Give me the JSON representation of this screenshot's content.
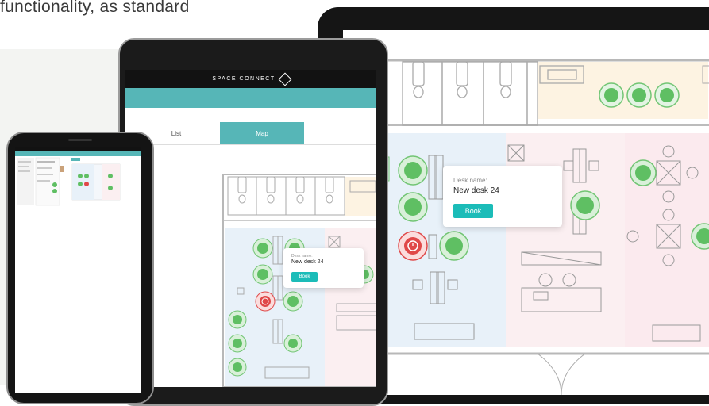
{
  "intro_text": "functionality, as standard",
  "brand": {
    "name": "SPACE CONNECT"
  },
  "tabs": {
    "list": "List",
    "map": "Map"
  },
  "legend": {
    "line1": "nd",
    "line2": "vailable",
    "line3": "ooked"
  },
  "popup": {
    "label": "Desk name:",
    "desk": "New desk 24",
    "book": "Book"
  },
  "colors": {
    "teal": "#56b6b7",
    "book": "#1bbcb8",
    "available": "#6cc36e",
    "booked": "#e04848"
  }
}
